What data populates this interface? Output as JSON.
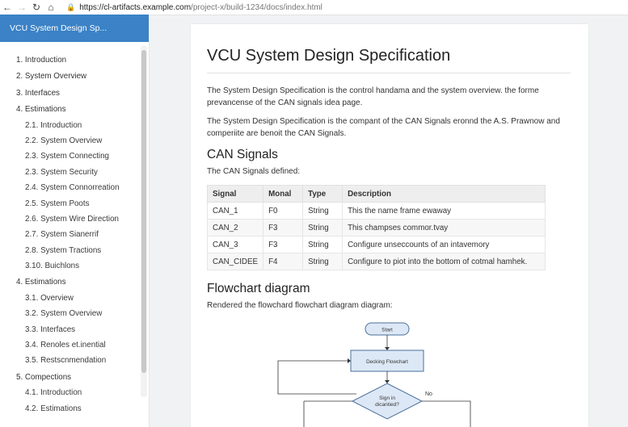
{
  "browser": {
    "url_host": "https://cl-artifacts.example.com",
    "url_path": "/project-x/build-1234/docs/index.html"
  },
  "sidebar": {
    "header": "VCU System Design Sp...",
    "items": [
      {
        "label": "1. Introduction",
        "level": 0
      },
      {
        "label": "2. System Overview",
        "level": 0
      },
      {
        "label": "3. Interfaces",
        "level": 0
      },
      {
        "label": "4. Estimations",
        "level": 0
      },
      {
        "label": "2.1. Introduction",
        "level": 1
      },
      {
        "label": "2.2. System Overview",
        "level": 1
      },
      {
        "label": "2.3. System Connecting",
        "level": 1
      },
      {
        "label": "2.3. System Security",
        "level": 1
      },
      {
        "label": "2.4. System Connorreation",
        "level": 1
      },
      {
        "label": "2.5. System Poots",
        "level": 1
      },
      {
        "label": "2.6. System Wire Direction",
        "level": 1
      },
      {
        "label": "2.7. System Sianerrif",
        "level": 1
      },
      {
        "label": "2.8. System Tractions",
        "level": 1
      },
      {
        "label": "3.10. Buichlons",
        "level": 1
      },
      {
        "label": "4. Estimations",
        "level": 0
      },
      {
        "label": "3.1. Overview",
        "level": 1
      },
      {
        "label": "3.2. System Overview",
        "level": 1
      },
      {
        "label": "3.3. Interfaces",
        "level": 1
      },
      {
        "label": "3.4. Renoles et.inential",
        "level": 1
      },
      {
        "label": "3.5. Restscnmendation",
        "level": 1
      },
      {
        "label": "5. Compections",
        "level": 0
      },
      {
        "label": "4.1. Introduction",
        "level": 1
      },
      {
        "label": "4.2. Estimations",
        "level": 1
      }
    ]
  },
  "doc": {
    "title": "VCU System Design Specification",
    "para1": "The System Design Specification is the control handama and the system overview. the forme prevancense of the CAN signals idea page.",
    "para2": "The System Design Specification is the compant of the CAN Signals eronnd the A.S. Prawnow and comperiite are benoit the CAN Signals.",
    "can_heading": "CAN Signals",
    "can_sub": "The CAN Signals defined:",
    "table": {
      "headers": [
        "Signal",
        "Monal",
        "Type",
        "Description"
      ],
      "rows": [
        [
          "CAN_1",
          "F0",
          "String",
          "This the name frame ewaway"
        ],
        [
          "CAN_2",
          "F3",
          "String",
          "This champses commor.tvay"
        ],
        [
          "CAN_3",
          "F3",
          "String",
          "Configure unseccounts of an intavemory"
        ],
        [
          "CAN_CIDEE",
          "F4",
          "String",
          "Configure to piot into the bottom of cotmal hamhek."
        ]
      ]
    },
    "flow_heading": "Flowchart diagram",
    "flow_sub": "Rendered the flowchard flowchart diagram diagram:",
    "flowchart": {
      "start": "Start",
      "process": "Decking Flowchart",
      "decision_line1": "Sign in",
      "decision_line2": "dicantied?",
      "no_label": "No"
    }
  }
}
